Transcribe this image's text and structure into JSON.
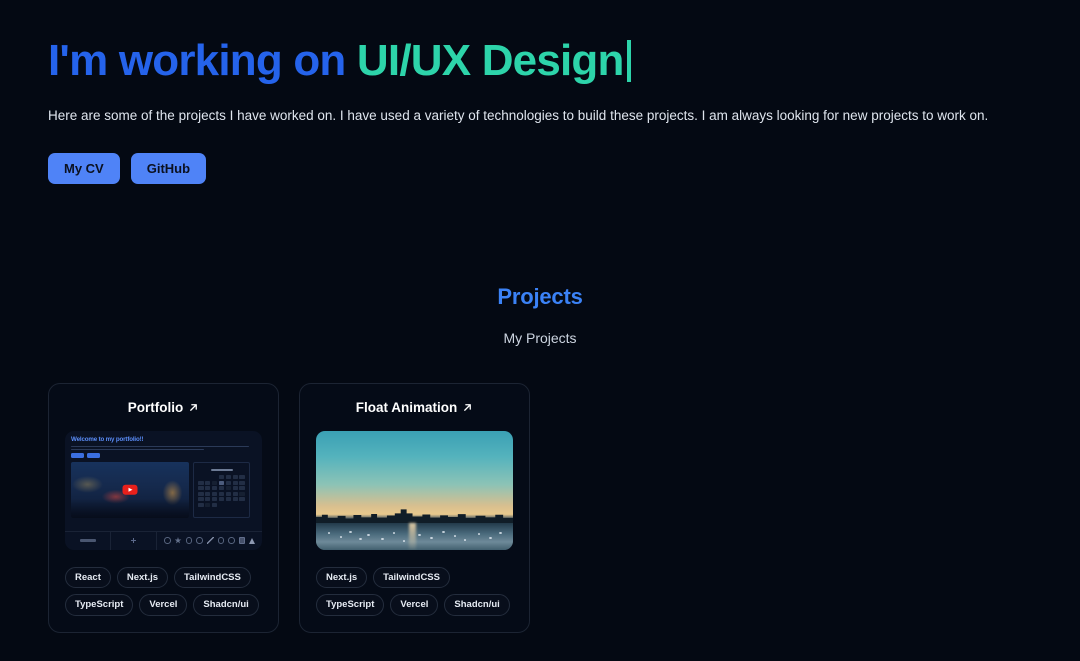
{
  "hero": {
    "heading_prefix": "I'm working on ",
    "heading_highlight": "UI/UX Design",
    "subtitle": "Here are some of the projects I have worked on. I have used a variety of technologies to build these projects. I am always looking for new projects to work on.",
    "buttons": [
      {
        "label": "My CV",
        "name": "my-cv-button"
      },
      {
        "label": "GitHub",
        "name": "github-button"
      }
    ],
    "colors": {
      "heading_prefix": "#2563eb",
      "heading_highlight": "#2dd4aa",
      "button_bg": "#4f83f7",
      "page_bg": "#040913"
    }
  },
  "projects": {
    "title": "Projects",
    "subtitle": "My Projects",
    "title_color": "#3b82f6",
    "cards": [
      {
        "title": "Portfolio",
        "link_icon": "arrow-up-right-icon",
        "preview": {
          "type": "website-screenshot",
          "headline": "Welcome to my portfolio!!",
          "headline_color": "#5b8df8",
          "media_caption": "video-thumbnail",
          "play_icon": "play-button-icon",
          "widget": "calendar-grid"
        },
        "tags": [
          "React",
          "Next.js",
          "TailwindCSS",
          "TypeScript",
          "Vercel",
          "Shadcn/ui"
        ]
      },
      {
        "title": "Float Animation",
        "link_icon": "arrow-up-right-icon",
        "preview": {
          "type": "photo",
          "description": "city skyline at sunset over water"
        },
        "tags": [
          "Next.js",
          "TailwindCSS",
          "TypeScript",
          "Vercel",
          "Shadcn/ui"
        ]
      }
    ]
  }
}
